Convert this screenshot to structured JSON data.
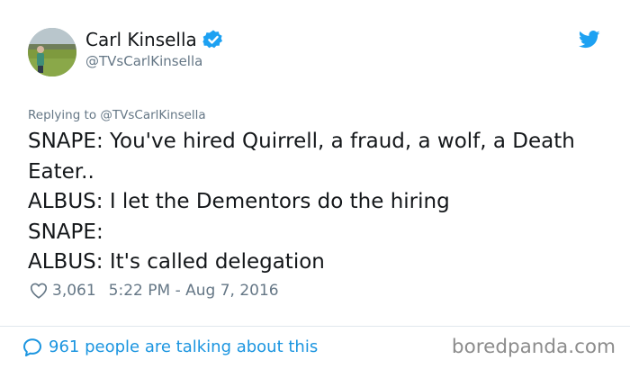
{
  "author": {
    "name": "Carl Kinsella",
    "handle": "@TVsCarlKinsella",
    "verified": true,
    "avatar_icon": "avatar-photo-field"
  },
  "reply": {
    "prefix": "Replying to",
    "mention": "@TVsCarlKinsella"
  },
  "tweet": {
    "lines": [
      "SNAPE: You've hired Quirrell, a fraud, a wolf, a Death",
      "Eater..",
      "ALBUS: I let the Dementors do the hiring",
      "SNAPE:",
      "ALBUS: It's called delegation"
    ]
  },
  "meta": {
    "likes": "3,061",
    "timestamp": "5:22 PM - Aug 7, 2016"
  },
  "footer": {
    "talking": "961 people are talking about this",
    "watermark": "boredpanda.com"
  },
  "colors": {
    "accent": "#1b95e0",
    "verified": "#1da1f2",
    "text": "#14171a",
    "muted": "#657786",
    "divider": "#e1e8ed",
    "watermark": "#8c8c8c"
  },
  "icons": {
    "verified": "verified-badge-icon",
    "brand": "twitter-bird-icon",
    "like": "heart-icon",
    "reply": "speech-bubble-icon"
  }
}
